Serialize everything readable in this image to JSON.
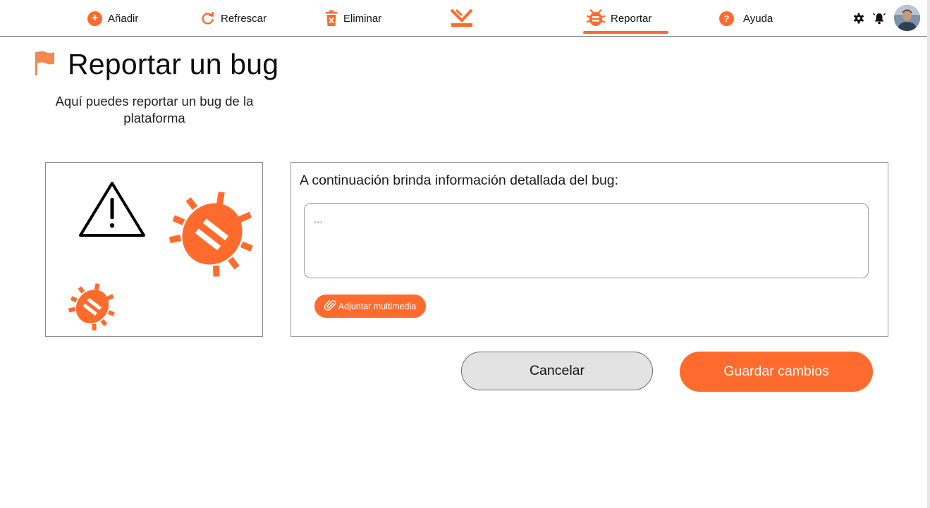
{
  "nav": {
    "add_label": "Añadir",
    "refresh_label": "Refrescar",
    "delete_label": "Eliminar",
    "report_label": "Reportar",
    "help_label": "Ayuda",
    "active_item": "Reportar",
    "icons": {
      "add": "plus-circle-icon",
      "refresh": "refresh-icon",
      "delete": "trash-icon",
      "logo": "brand-logo",
      "report": "bug-icon",
      "help": "question-circle-icon",
      "settings": "gear-icon",
      "notifications": "bell-icon",
      "avatar": "user-avatar"
    }
  },
  "page": {
    "title": "Reportar un bug",
    "title_icon": "flag-icon",
    "subtitle": "Aquí puedes reportar un bug de la plataforma"
  },
  "illustration": {
    "icons": [
      "warning-triangle-icon",
      "bug-icon",
      "bug-icon"
    ]
  },
  "form": {
    "prompt": "A continuación brinda información detallada del bug:",
    "details_placeholder": "...",
    "details_value": "",
    "attach_label": "Adjuntar multimedia",
    "attach_icon": "paperclip-icon"
  },
  "actions": {
    "cancel_label": "Cancelar",
    "save_label": "Guardar cambios"
  },
  "colors": {
    "accent": "#ff6b2c",
    "cancel_bg": "#e3e3e3",
    "border": "#8c8c8c"
  }
}
